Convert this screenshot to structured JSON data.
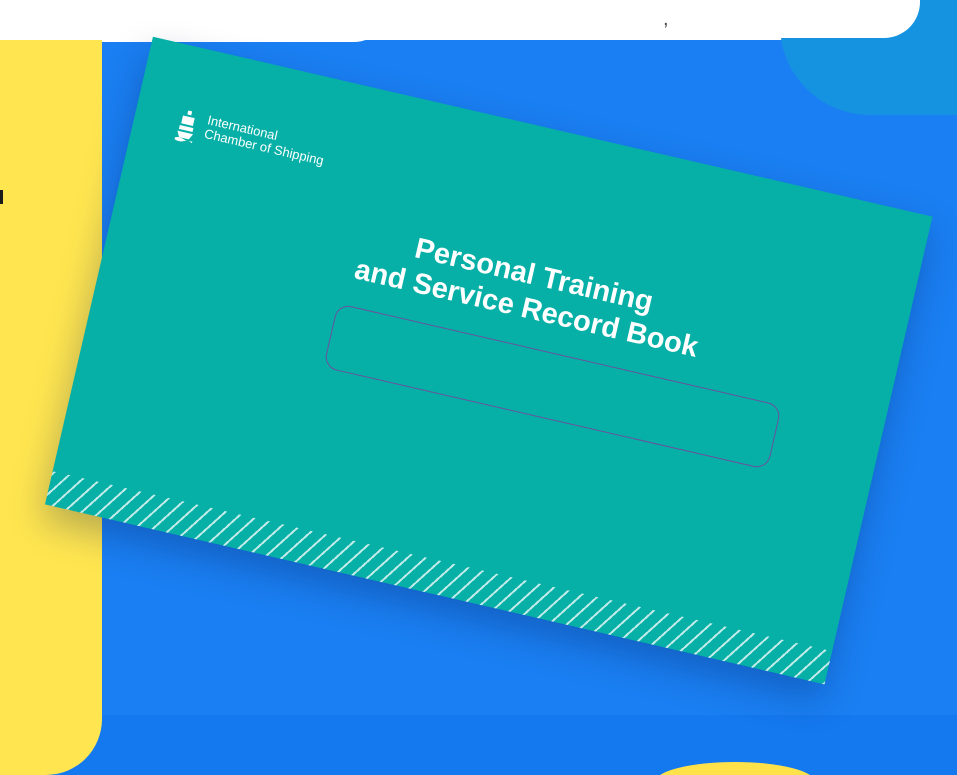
{
  "top_right_card": {
    "partial_text": ","
  },
  "book": {
    "logo_line1": "International",
    "logo_line2": "Chamber of Shipping",
    "title_line1": "Personal Training",
    "title_line2": "and Service Record Book",
    "name_box_value": ""
  },
  "colors": {
    "background_blue": "#1a7ff2",
    "panel_yellow": "#ffe650",
    "book_teal": "#06b0a6",
    "name_box_border": "#74489c"
  }
}
